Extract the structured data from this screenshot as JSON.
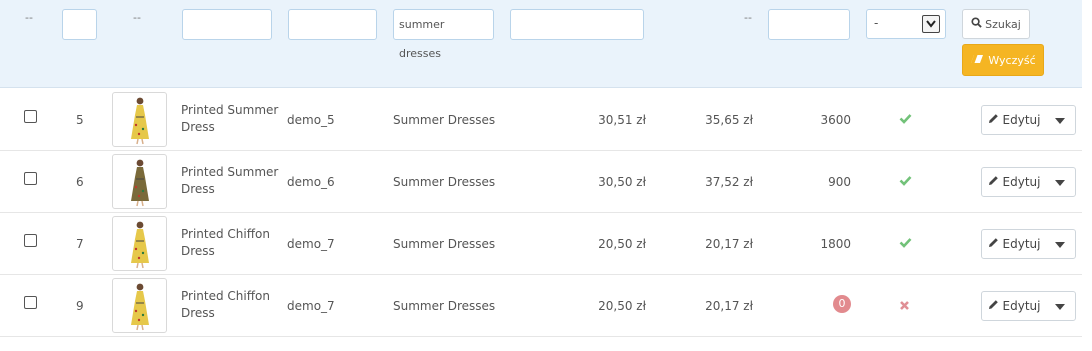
{
  "filters": {
    "id_dash": "--",
    "image_dash": "--",
    "category_value": "summer dresses",
    "price_dash": "--",
    "status_selected": "-",
    "search_label": "Szukaj",
    "clear_label": "Wyczyść"
  },
  "rows": [
    {
      "id": "5",
      "name": "Printed Summer Dress",
      "reference": "demo_5",
      "category": "Summer Dresses",
      "base_price": "30,51 zł",
      "final_price": "35,65 zł",
      "quantity": "3600",
      "quantity_zero": false,
      "status": "enabled",
      "edit_label": "Edytuj"
    },
    {
      "id": "6",
      "name": "Printed Summer Dress",
      "reference": "demo_6",
      "category": "Summer Dresses",
      "base_price": "30,50 zł",
      "final_price": "37,52 zł",
      "quantity": "900",
      "quantity_zero": false,
      "status": "enabled",
      "edit_label": "Edytuj"
    },
    {
      "id": "7",
      "name": "Printed Chiffon Dress",
      "reference": "demo_7",
      "category": "Summer Dresses",
      "base_price": "20,50 zł",
      "final_price": "20,17 zł",
      "quantity": "1800",
      "quantity_zero": false,
      "status": "enabled",
      "edit_label": "Edytuj"
    },
    {
      "id": "9",
      "name": "Printed Chiffon Dress",
      "reference": "demo_7",
      "category": "Summer Dresses",
      "base_price": "20,50 zł",
      "final_price": "20,17 zł",
      "quantity": "0",
      "quantity_zero": true,
      "status": "disabled",
      "edit_label": "Edytuj"
    }
  ],
  "colors": {
    "filter_bg": "#eaf3fb",
    "clear_button": "#f5b523",
    "status_enabled": "#72c279",
    "status_disabled": "#e08f95",
    "zero_badge": "#e28a8e"
  }
}
